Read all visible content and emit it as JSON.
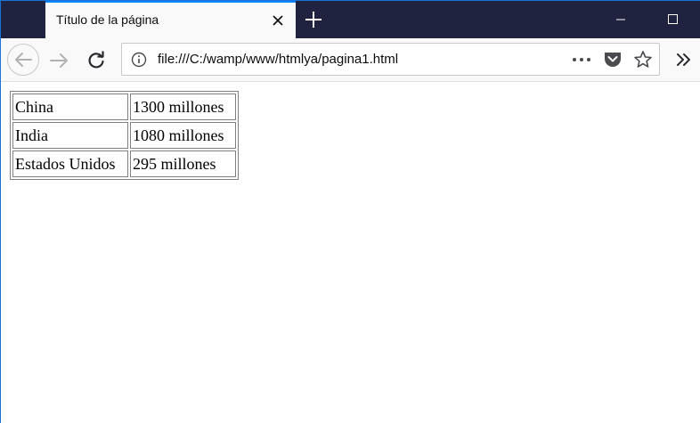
{
  "browser": {
    "tab": {
      "title": "Título de la página",
      "close_icon": "close-icon"
    },
    "new_tab_icon": "plus-icon",
    "window_controls": [
      "minimize-icon",
      "maximize-icon"
    ],
    "toolbar": {
      "back_icon": "back-arrow-icon",
      "forward_icon": "forward-arrow-icon",
      "reload_icon": "reload-icon",
      "url": "file:///C:/wamp/www/htmlya/pagina1.html",
      "page_actions": [
        "more-icon",
        "pocket-icon",
        "star-icon"
      ],
      "overflow_icon": "chevron-double-right-icon"
    },
    "colors": {
      "titlebar": "#202340",
      "tab_bg": "#f9f9fa",
      "accent": "#0a84ff"
    }
  },
  "page": {
    "table": {
      "rows": [
        [
          "China",
          "1300 millones"
        ],
        [
          "India",
          "1080 millones"
        ],
        [
          "Estados Unidos",
          "295 millones"
        ]
      ]
    }
  }
}
